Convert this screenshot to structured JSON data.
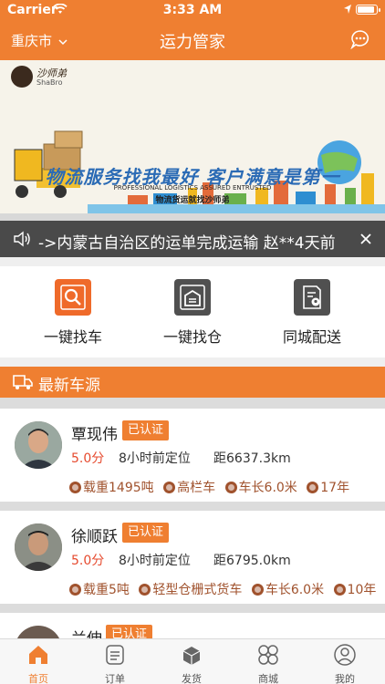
{
  "status_bar": {
    "carrier": "Carrier",
    "time": "3:33 AM"
  },
  "nav": {
    "city": "重庆市",
    "title": "运力管家"
  },
  "banner": {
    "logo_cn": "沙师弟",
    "logo_en": "ShaBro",
    "slogan": "物流服务找我最好   客户满意是第一",
    "slogan_en": "PROFESSIONAL LOGISTICS ASSURED ENTRUSTED",
    "slogan_sub": "物流货运就找沙师弟"
  },
  "notice": {
    "text": "->内蒙古自治区的运单完成运输   赵**4天前"
  },
  "quick_actions": [
    {
      "label": "一键找车",
      "icon": "search-icon",
      "color": "#ef6a2a"
    },
    {
      "label": "一键找仓",
      "icon": "warehouse-icon",
      "color": "#505050"
    },
    {
      "label": "同城配送",
      "icon": "location-document-icon",
      "color": "#505050"
    }
  ],
  "section": {
    "title": "最新车源"
  },
  "drivers": [
    {
      "name": "覃现伟",
      "badge": "已认证",
      "score": "5.0分",
      "located": "8小时前定位",
      "distance": "距6637.3km",
      "tags": [
        "载重1495吨",
        "高栏车",
        "车长6.0米",
        "17年"
      ]
    },
    {
      "name": "徐顺跃",
      "badge": "已认证",
      "score": "5.0分",
      "located": "8小时前定位",
      "distance": "距6795.0km",
      "tags": [
        "载重5吨",
        "轻型仓栅式货车",
        "车长6.0米",
        "10年"
      ]
    },
    {
      "name": "兰伸",
      "badge": "已认证"
    }
  ],
  "tabs": [
    {
      "label": "首页",
      "icon": "home-icon",
      "active": true
    },
    {
      "label": "订单",
      "icon": "order-icon"
    },
    {
      "label": "发货",
      "icon": "ship-icon"
    },
    {
      "label": "商城",
      "icon": "mall-icon"
    },
    {
      "label": "我的",
      "icon": "profile-icon"
    }
  ],
  "colors": {
    "primary": "#ef7f31",
    "score": "#e64a2e",
    "tag": "#a0522d"
  }
}
